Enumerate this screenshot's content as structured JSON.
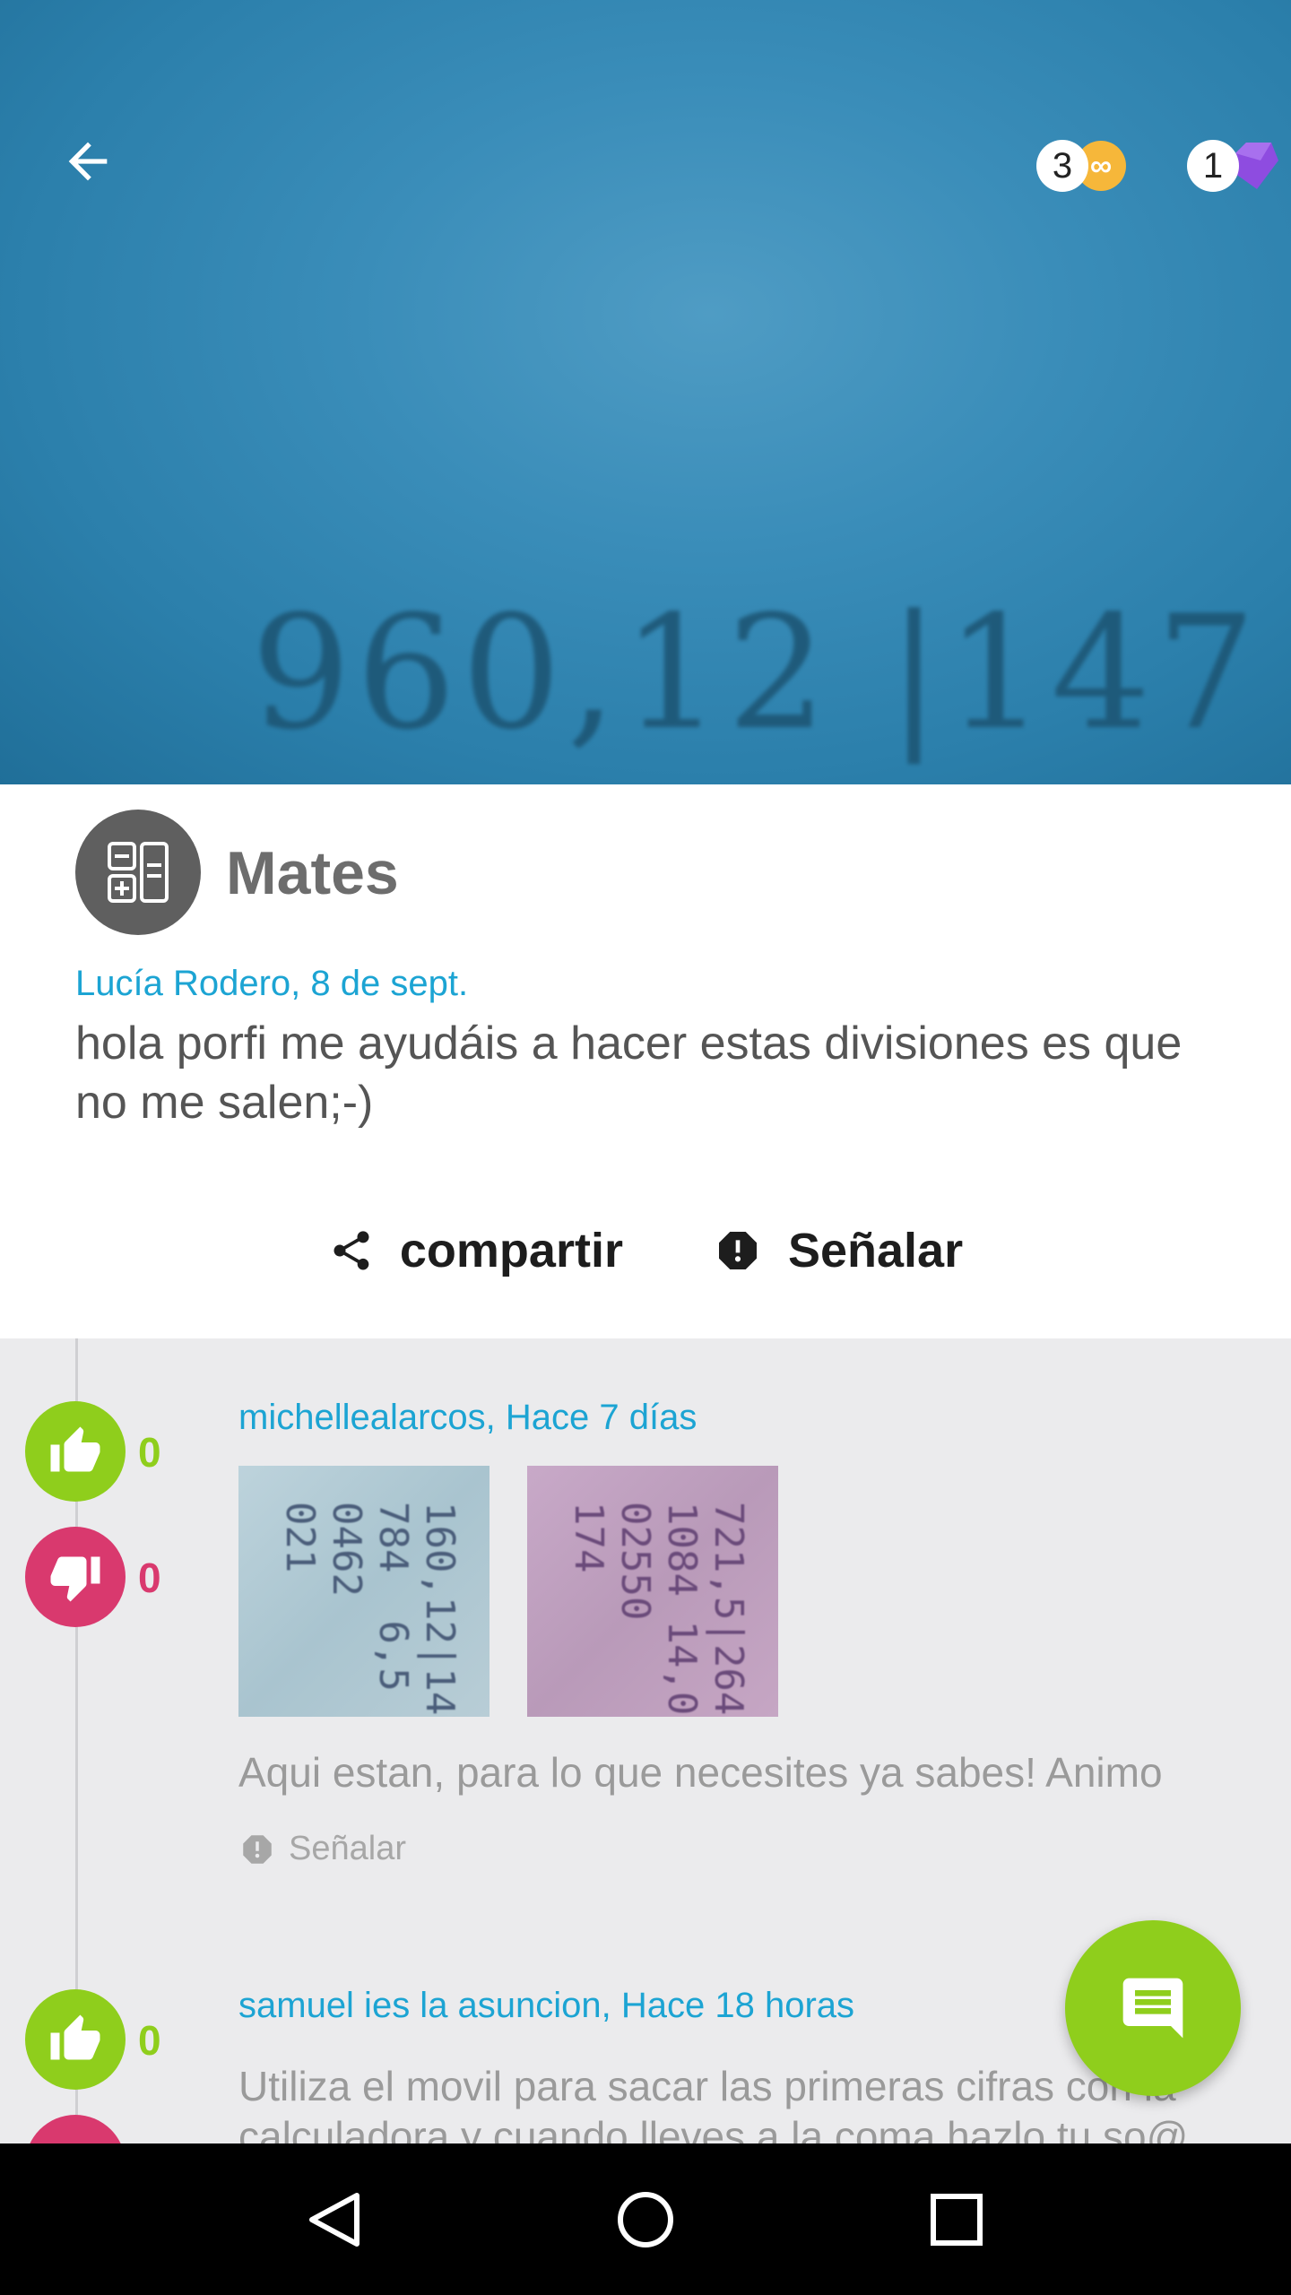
{
  "hero": {
    "photo_text": "960,12 |147",
    "badges": [
      {
        "count": "3",
        "icon": "infinity-coin-icon",
        "symbol": "∞",
        "color": "#f6b73a"
      },
      {
        "count": "1",
        "icon": "purple-gem-icon",
        "color": "#8e4ce0"
      }
    ]
  },
  "post": {
    "subject": "Mates",
    "subject_icon": "calculator-icon",
    "meta": "Lucía Rodero, 8 de sept.",
    "text": "hola porfi me ayudáis a hacer estas divisiones es que no me salen;-)",
    "share_label": "compartir",
    "report_label": "Señalar"
  },
  "answers": [
    {
      "meta": "michellealarcos, Hace 7 días",
      "likes": "0",
      "dislikes": "0",
      "text": "Aqui estan, para lo que necesites ya sabes! Animo",
      "report_label": "Señalar"
    },
    {
      "meta": "samuel ies la asuncion, Hace 18 horas",
      "likes": "0",
      "text": "Utiliza el movil para sacar las primeras cifras con la calculadora y cuando lleves a la coma hazlo tu so@"
    }
  ],
  "colors": {
    "accent_blue": "#1ca4d3",
    "like_green": "#8fce1c",
    "dislike_pink": "#d9396e"
  }
}
